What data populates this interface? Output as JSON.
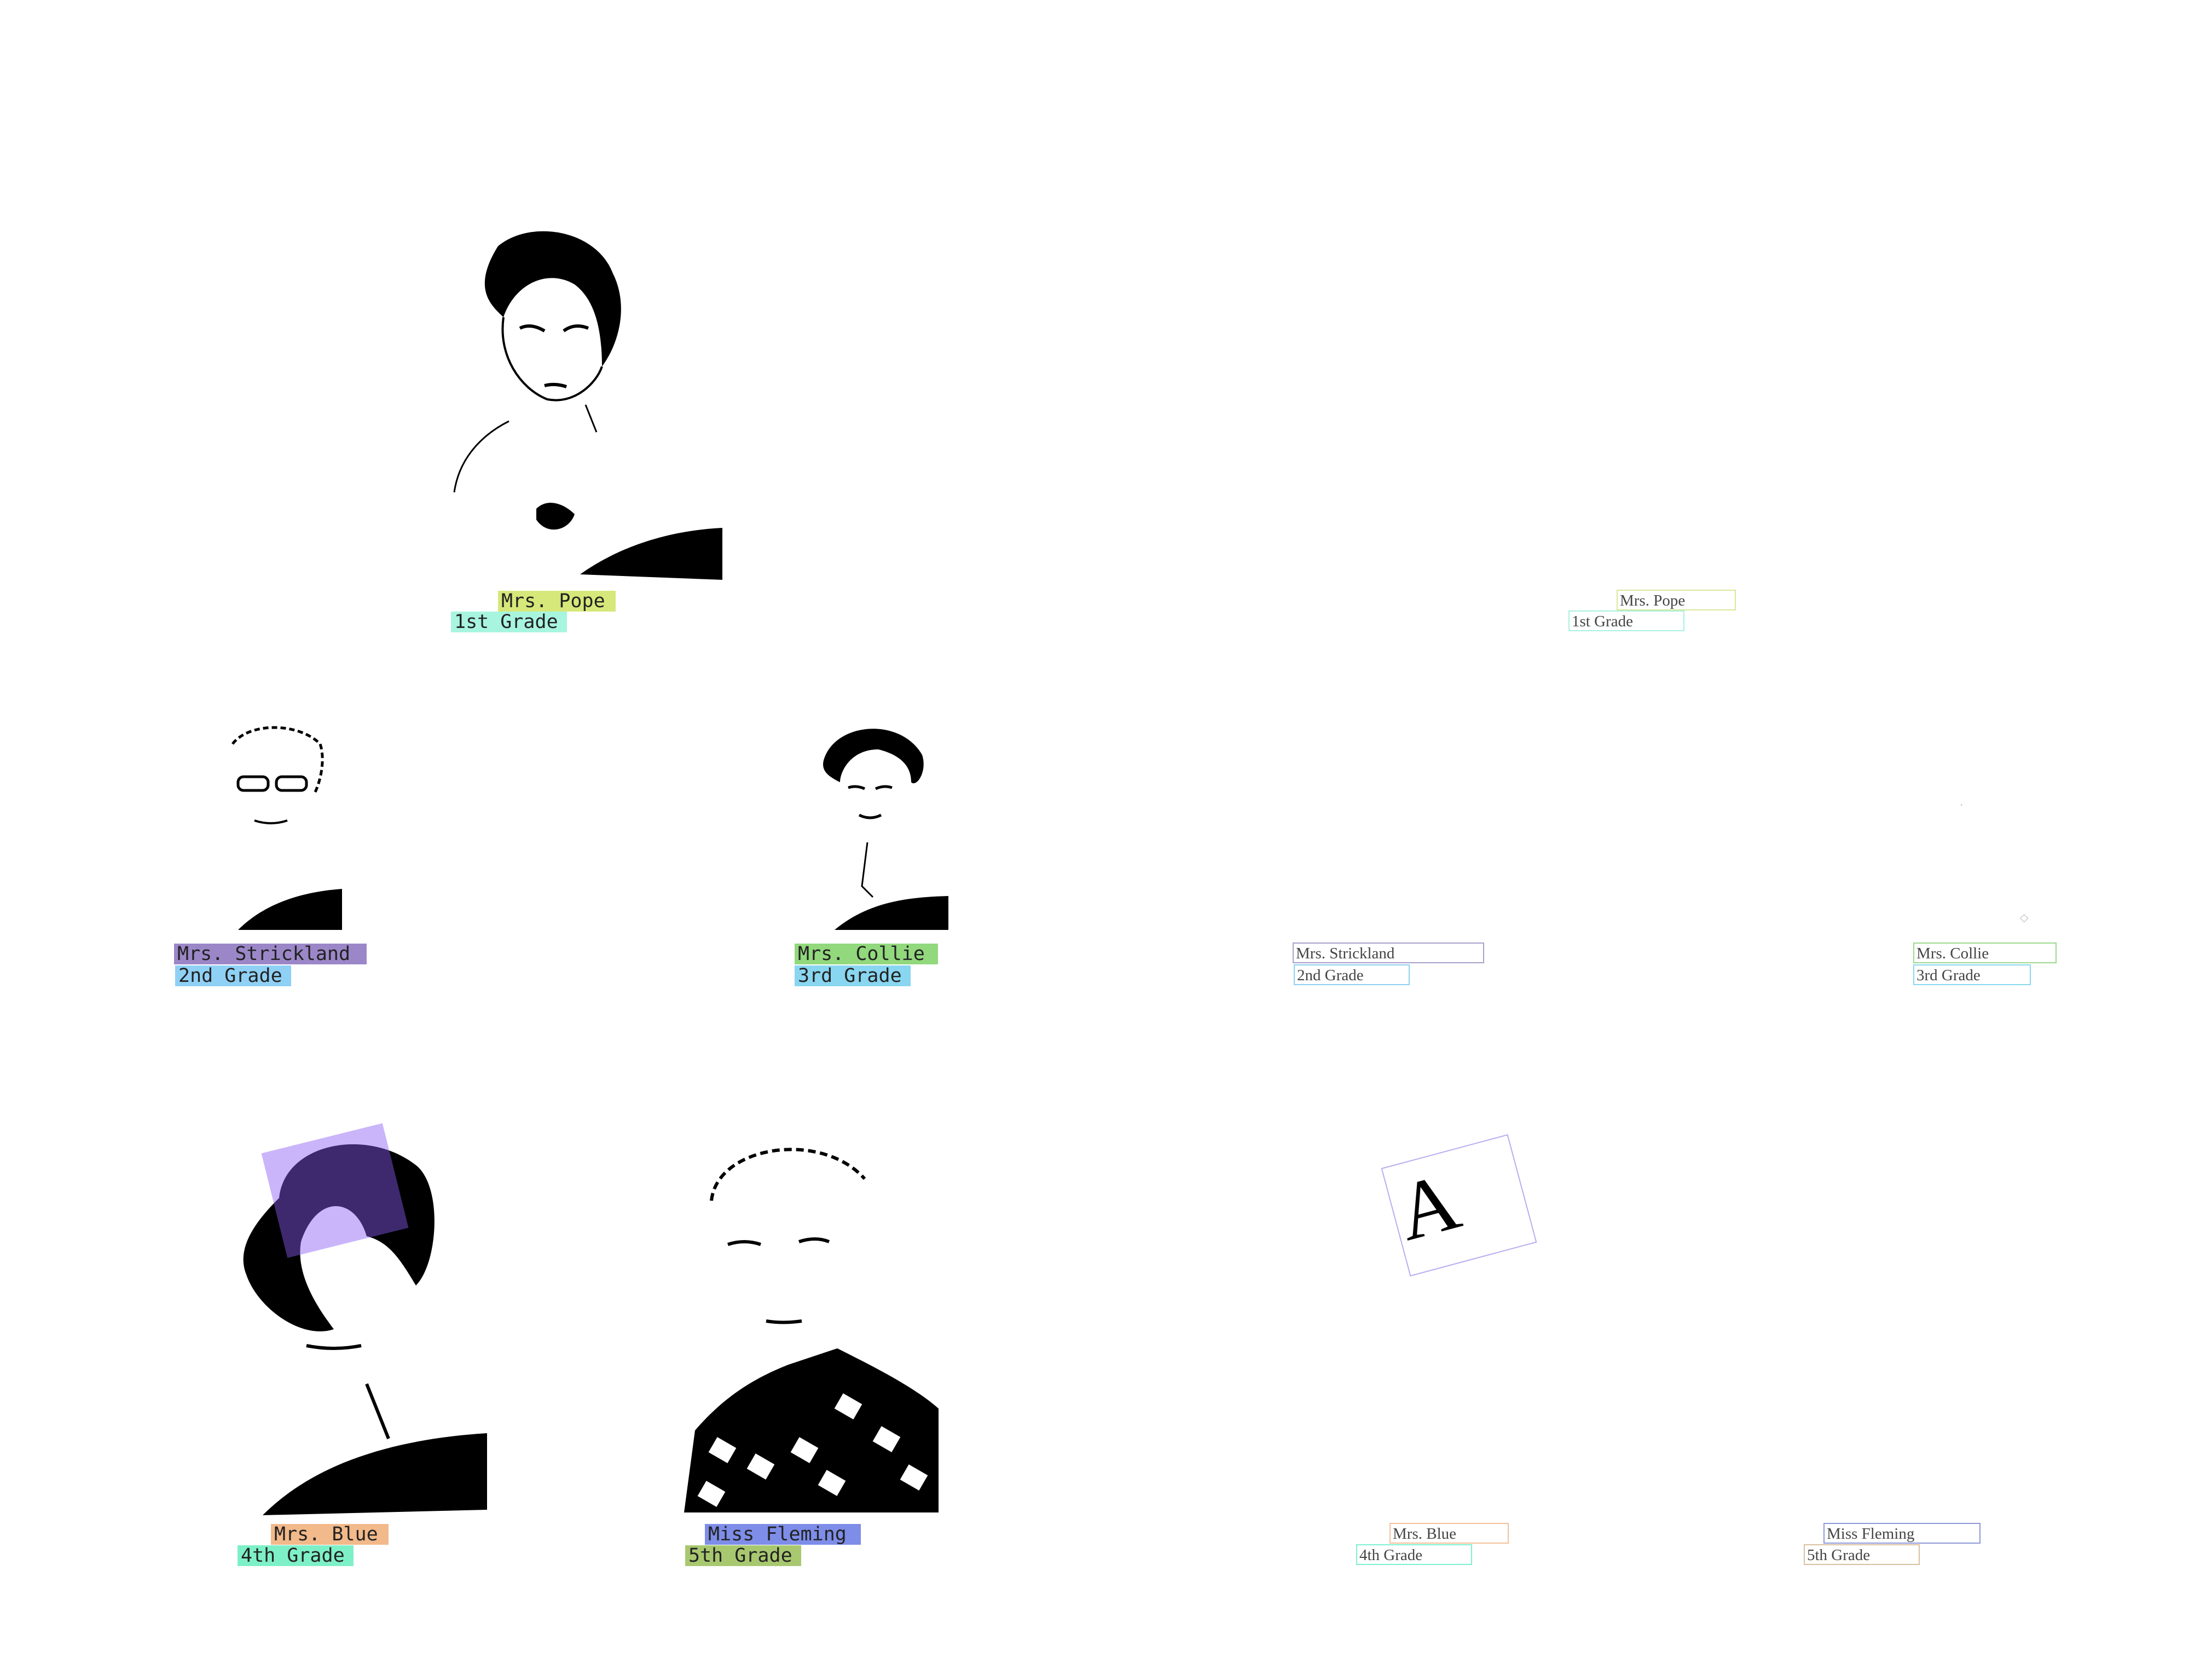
{
  "teachers": [
    {
      "name": "Mrs. Pope",
      "grade": "1st Grade",
      "name_color": "#d6e87a",
      "grade_color": "#a8f5df",
      "name_box_color": "#d9e89a",
      "grade_box_color": "#a8f0e0"
    },
    {
      "name": "Mrs. Strickland",
      "grade": "2nd Grade",
      "name_color": "#9b87c8",
      "grade_color": "#8fd0f5",
      "name_box_color": "#a8a0c8",
      "grade_box_color": "#8fd0f0"
    },
    {
      "name": "Mrs. Collie",
      "grade": "3rd Grade",
      "name_color": "#92d87d",
      "grade_color": "#88d6f0",
      "name_box_color": "#9bd88c",
      "grade_box_color": "#88d8ef"
    },
    {
      "name": "Mrs. Blue",
      "grade": "4th Grade",
      "name_color": "#f2b98a",
      "grade_color": "#7ef0c8",
      "name_box_color": "#f2c09a",
      "grade_box_color": "#7ef0d0"
    },
    {
      "name": "Miss Fleming",
      "grade": "5th Grade",
      "name_color": "#7d8de8",
      "grade_color": "#a8c870",
      "name_box_color": "#8d98d8",
      "grade_box_color": "#d8c0a0"
    }
  ],
  "right_panel": {
    "strickland_name": "Mrs. Strickland",
    "collie_name": "Mrs. Collie",
    "glyph": "A"
  }
}
